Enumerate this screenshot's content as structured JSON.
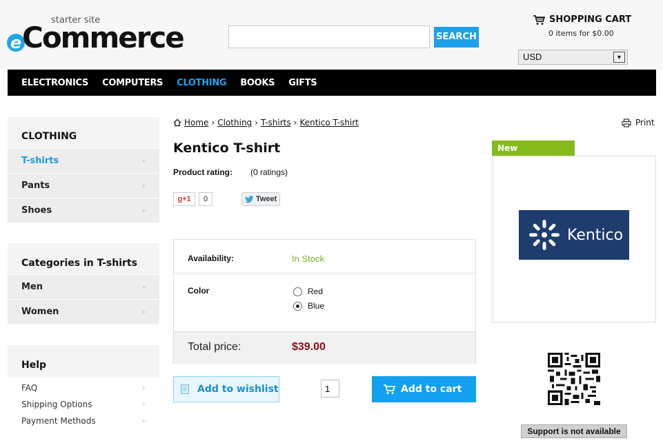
{
  "header": {
    "logo_small": "starter site",
    "logo_e": "e",
    "logo_main": "Commerce",
    "search_placeholder": "",
    "search_button": "SEARCH",
    "cart_title": "SHOPPING CART",
    "cart_summary": "0 items for $0.00",
    "currency": "USD"
  },
  "nav": {
    "items": [
      "ELECTRONICS",
      "COMPUTERS",
      "CLOTHING",
      "BOOKS",
      "GIFTS"
    ],
    "active": "CLOTHING"
  },
  "sidebar": {
    "section1_title": "CLOTHING",
    "section1_items": [
      "T-shirts",
      "Pants",
      "Shoes"
    ],
    "section2_title": "Categories in T-shirts",
    "section2_items": [
      "Men",
      "Women"
    ],
    "help_title": "Help",
    "help_items": [
      "FAQ",
      "Shipping Options",
      "Payment Methods"
    ],
    "arrow": "▹"
  },
  "breadcrumb": {
    "items": [
      "Home",
      "Clothing",
      "T-shirts",
      "Kentico T-shirt"
    ],
    "separator": "›"
  },
  "print_label": "Print",
  "product": {
    "title": "Kentico T-shirt",
    "rating_label": "Product rating:",
    "rating_value": "(0 ratings)",
    "gplus_label": "g+1",
    "gplus_count": "0",
    "tweet_label": "Tweet",
    "availability_label": "Availability:",
    "availability_value": "In Stock",
    "color_label": "Color",
    "color_options": [
      "Red",
      "Blue"
    ],
    "color_selected": "Blue",
    "total_label": "Total price:",
    "total_value": "$39.00",
    "wishlist_label": "Add to wishlist",
    "quantity": "1",
    "add_to_cart_label": "Add to cart",
    "badge": "New",
    "brand_text": "Kentico",
    "support_text": "Support is not available"
  },
  "colors": {
    "accent": "#1ba1ea",
    "nav_bg": "#000000",
    "in_stock": "#7fb21f",
    "price": "#8b0a14",
    "badge": "#84bb1a"
  }
}
